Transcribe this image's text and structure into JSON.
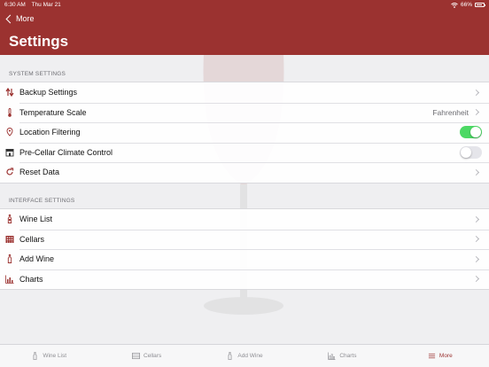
{
  "status_bar": {
    "time": "6:30 AM",
    "date": "Thu Mar 21",
    "battery": "66%"
  },
  "nav": {
    "back_label": "More",
    "title": "Settings"
  },
  "system_section": {
    "header": "SYSTEM SETTINGS",
    "rows": [
      {
        "label": "Backup Settings",
        "icon": "backup-arrows-icon"
      },
      {
        "label": "Temperature Scale",
        "icon": "thermometer-icon",
        "value": "Fahrenheit"
      },
      {
        "label": "Location Filtering",
        "icon": "location-pin-icon",
        "toggle": true
      },
      {
        "label": "Pre-Cellar Climate Control",
        "icon": "store-icon",
        "toggle": false
      },
      {
        "label": "Reset Data",
        "icon": "reset-icon"
      }
    ]
  },
  "interface_section": {
    "header": "INTERFACE SETTINGS",
    "rows": [
      {
        "label": "Wine List",
        "icon": "wine-bottle-icon"
      },
      {
        "label": "Cellars",
        "icon": "wine-rack-icon"
      },
      {
        "label": "Add Wine",
        "icon": "add-bottle-icon"
      },
      {
        "label": "Charts",
        "icon": "bar-chart-icon"
      }
    ]
  },
  "tabbar": {
    "tabs": [
      {
        "label": "Wine List",
        "icon": "wine-bottle-icon",
        "active": false
      },
      {
        "label": "Cellars",
        "icon": "wine-rack-icon",
        "active": false
      },
      {
        "label": "Add Wine",
        "icon": "add-bottle-icon",
        "active": false
      },
      {
        "label": "Charts",
        "icon": "bar-chart-icon",
        "active": false
      },
      {
        "label": "More",
        "icon": "menu-lines-icon",
        "active": true
      }
    ]
  },
  "colors": {
    "accent": "#9b3230",
    "toggle_on": "#4cd964",
    "background": "#efeff1"
  }
}
